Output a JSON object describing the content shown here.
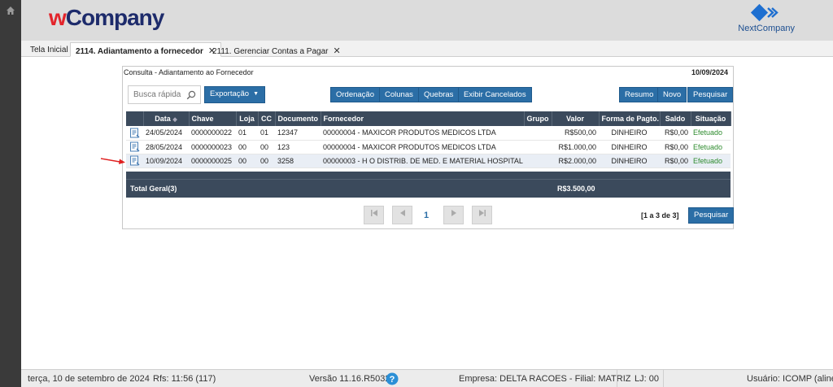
{
  "header": {
    "logo_w": "w",
    "logo_rest": "Company",
    "brand": "NextCompany"
  },
  "tabs": [
    {
      "label": "Tela Inicial"
    },
    {
      "label": "2114. Adiantamento a fornecedor",
      "close": "✕"
    },
    {
      "label": "2111. Gerenciar Contas a Pagar",
      "close": "✕"
    }
  ],
  "panel": {
    "title": "Consulta - Adiantamento ao Fornecedor",
    "date": "10/09/2024"
  },
  "toolbar": {
    "search_placeholder": "Busca rápida",
    "exportacao": "Exportação",
    "ordenacao": "Ordenação",
    "colunas": "Colunas",
    "quebras": "Quebras",
    "exibir_cancelados": "Exibir Cancelados",
    "resumo": "Resumo",
    "novo": "Novo",
    "pesquisar": "Pesquisar"
  },
  "grid": {
    "columns": [
      "Data",
      "Chave",
      "Loja",
      "CC",
      "Documento",
      "Fornecedor",
      "Grupo",
      "Valor",
      "Forma de Pagto.",
      "Saldo",
      "Situação"
    ],
    "rows": [
      [
        "24/05/2024",
        "0000000022",
        "01",
        "01",
        "12347",
        "00000004 - MAXICOR PRODUTOS MEDICOS LTDA",
        "",
        "R$500,00",
        "DINHEIRO",
        "R$0,00",
        "Efetuado"
      ],
      [
        "28/05/2024",
        "0000000023",
        "00",
        "00",
        "123",
        "00000004 - MAXICOR PRODUTOS MEDICOS LTDA",
        "",
        "R$1.000,00",
        "DINHEIRO",
        "R$0,00",
        "Efetuado"
      ],
      [
        "10/09/2024",
        "0000000025",
        "00",
        "00",
        "3258",
        "00000003 - H O DISTRIB. DE MED. E MATERIAL HOSPITAL",
        "",
        "R$2.000,00",
        "DINHEIRO",
        "R$0,00",
        "Efetuado"
      ]
    ],
    "total_label": "Total Geral(3)",
    "total_value": "R$3.500,00"
  },
  "pager": {
    "current": "1",
    "info": "[1 a 3 de 3]",
    "pesquisar": "Pesquisar"
  },
  "status": {
    "date": "terça, 10 de setembro de 2024",
    "rfs": "Rfs: 11:56 (117)",
    "versao": "Versão 11.16.R5032",
    "empresa": "Empresa: DELTA RACOES - Filial: MATRIZ",
    "lj": "LJ: 00",
    "usuario": "Usuário: ICOMP (aline)"
  },
  "colors": {
    "accent": "#2b6ea6",
    "grid_header": "#3b4a5c",
    "status_ok": "#2e8b2e",
    "logo_red": "#e3242b",
    "logo_navy": "#1d2b6b"
  }
}
